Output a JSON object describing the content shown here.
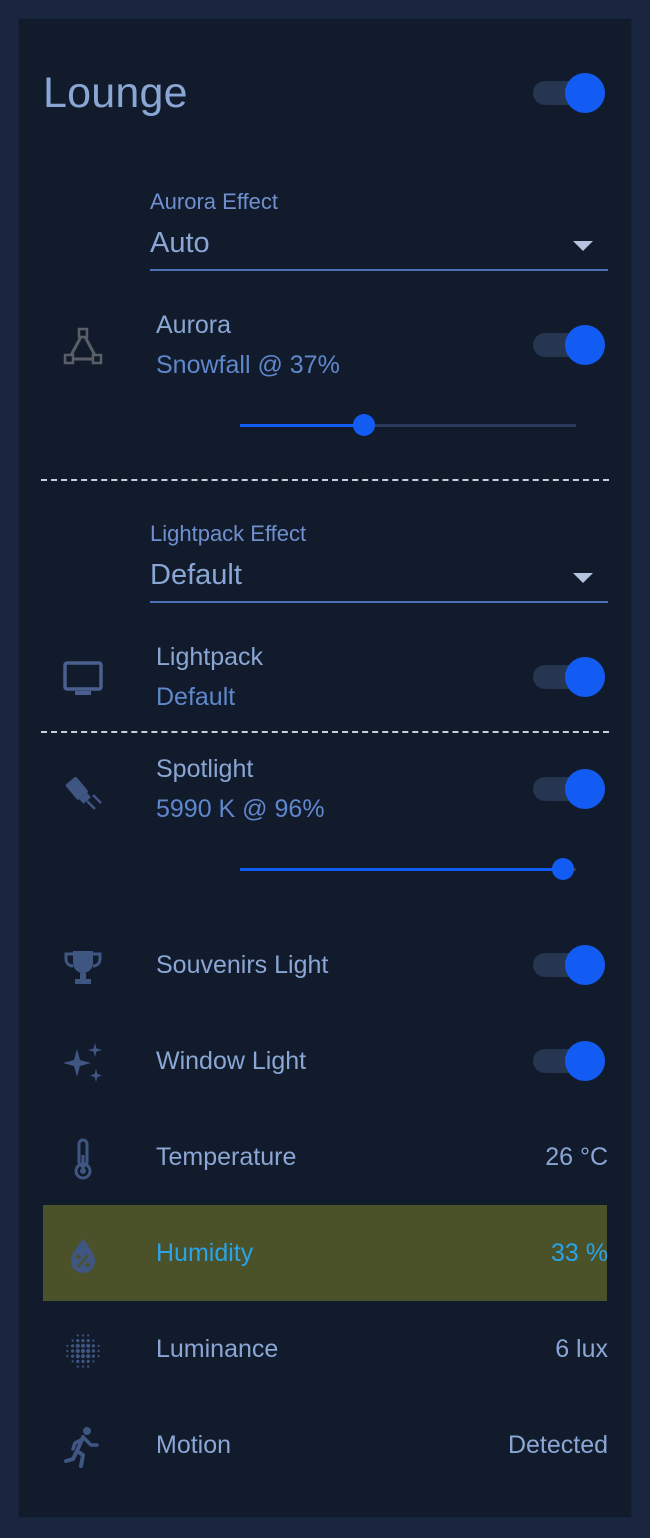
{
  "card": {
    "title": "Lounge",
    "master_toggle": true
  },
  "aurora_effect": {
    "label": "Aurora Effect",
    "value": "Auto"
  },
  "aurora": {
    "name": "Aurora",
    "status": "Snowfall @ 37%",
    "on": true,
    "brightness": 0.37,
    "icon": "triangle-nodes-icon"
  },
  "lightpack_effect": {
    "label": "Lightpack Effect",
    "value": "Default"
  },
  "lightpack": {
    "name": "Lightpack",
    "status": "Default",
    "on": true,
    "icon": "monitor-icon"
  },
  "spotlight": {
    "name": "Spotlight",
    "status": "5990 K @ 96%",
    "on": true,
    "brightness": 0.96,
    "icon": "spotlight-icon"
  },
  "souvenirs_light": {
    "name": "Souvenirs Light",
    "on": true,
    "icon": "trophy-icon"
  },
  "window_light": {
    "name": "Window Light",
    "on": true,
    "icon": "sparkles-icon"
  },
  "sensors": [
    {
      "name": "Temperature",
      "value": "26 °C",
      "icon": "thermometer-icon"
    },
    {
      "name": "Humidity",
      "value": "33 %",
      "icon": "water-percent-icon",
      "highlighted": true
    },
    {
      "name": "Luminance",
      "value": "6 lux",
      "icon": "brightness-dots-icon"
    },
    {
      "name": "Motion",
      "value": "Detected",
      "icon": "walking-person-icon"
    }
  ],
  "colors": {
    "accent": "#135cf3",
    "card_bg": "#121b2c",
    "text": "#8aa6d4",
    "highlight_bg": "#4b5129",
    "highlight_text": "#29a4e9"
  }
}
